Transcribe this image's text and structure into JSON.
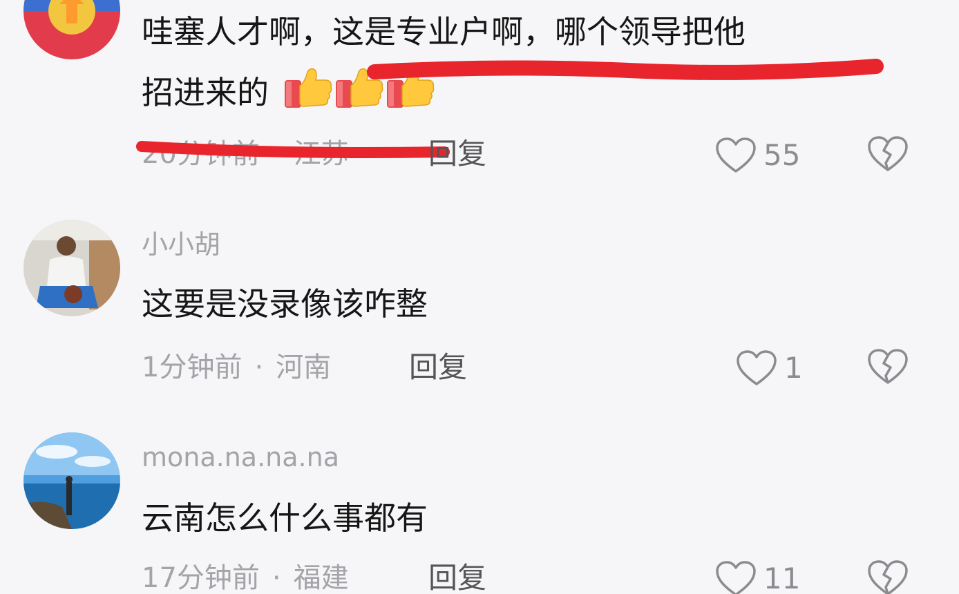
{
  "comments": [
    {
      "username": "",
      "content_line1": "哇塞人才啊，这是专业户啊，哪个领导把他",
      "content_line2": "招进来的",
      "time": "20分钟前",
      "location": "江苏",
      "separator": "·",
      "reply_label": "回复",
      "likes": "55",
      "emoji": [
        "thumbs-up",
        "thumbs-up",
        "thumbs-up"
      ]
    },
    {
      "username": "小小胡",
      "content": "这要是没录像该咋整",
      "time": "1分钟前",
      "location": "河南",
      "separator": "·",
      "reply_label": "回复",
      "likes": "1"
    },
    {
      "username": "mona.na.na.na",
      "content": "云南怎么什么事都有",
      "time": "17分钟前",
      "location": "福建",
      "separator": "·",
      "reply_label": "回复",
      "likes": "11"
    }
  ],
  "colors": {
    "background": "#f6f6f8",
    "text_primary": "#161616",
    "text_secondary": "#a3a3a8",
    "annotation_red": "#e8242c"
  },
  "icons": {
    "like": "heart-outline-icon",
    "dislike": "broken-heart-icon",
    "emoji": "thumbs-up-emoji-icon"
  }
}
